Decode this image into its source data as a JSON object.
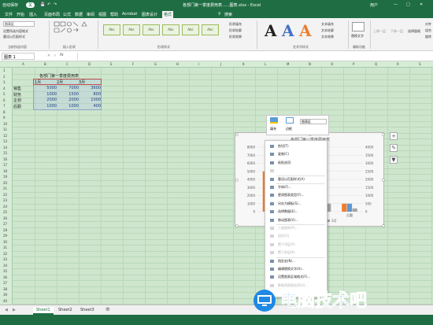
{
  "titlebar": {
    "autosave": "自动保存",
    "toggle": "关",
    "doc_title": "各部门第一季度费用表......图表.xlsx - Excel",
    "user": "用户"
  },
  "tabs": [
    "文件",
    "开始",
    "插入",
    "页面布局",
    "公式",
    "数据",
    "审阅",
    "视图",
    "帮助",
    "Acrobat",
    "图表设计",
    "格式"
  ],
  "active_tab": "格式",
  "tell_me": "搜索",
  "ribbon": {
    "selection_dropdown": "图表区",
    "format_selection": "设置所选内容格式",
    "reset_style": "重设以匹配样式",
    "group_current": "当前所选内容",
    "group_insert_shapes": "插入形状",
    "group_shape_styles": "形状样式",
    "group_art": "艺术字样式",
    "group_accessibility": "辅助功能",
    "style_label": "Abc",
    "shape_fill": "形状填充",
    "shape_outline": "形状轮廓",
    "shape_effect": "形状效果",
    "text_fill": "文本填充",
    "text_outline": "文本轮廓",
    "text_effect": "文本效果",
    "alt_text": "替换文字",
    "bring_forward": "上移一层",
    "send_backward": "下移一层",
    "selection_pane": "选择窗格",
    "align": "对齐",
    "combine": "组合",
    "rotate": "旋转",
    "art_letter": "A"
  },
  "formula_bar": {
    "name_box": "图表 1",
    "fx": "fx"
  },
  "columns": [
    "A",
    "B",
    "C",
    "D",
    "E",
    "F",
    "G",
    "H",
    "I",
    "J",
    "K",
    "L",
    "M",
    "N",
    "O",
    "P",
    "Q",
    "R",
    "S"
  ],
  "rows": [
    "1",
    "2",
    "3",
    "4",
    "5",
    "6",
    "7",
    "8",
    "9",
    "10",
    "11",
    "12",
    "13",
    "14",
    "15",
    "16",
    "17",
    "18",
    "19",
    "20",
    "21",
    "22",
    "23",
    "24",
    "25",
    "26",
    "27",
    "28",
    "29",
    "30",
    "31",
    "32",
    "33",
    "34",
    "35",
    "36",
    "37",
    "38",
    "39",
    "40"
  ],
  "table": {
    "title": "各部门第一季度费用表",
    "headers": [
      "1月",
      "2月",
      "3月"
    ],
    "rows": [
      {
        "dept": "销售",
        "values": [
          "5000",
          "7000",
          "3600"
        ]
      },
      {
        "dept": "财务",
        "values": [
          "1000",
          "1500",
          "800"
        ]
      },
      {
        "dept": "企划",
        "values": [
          "2000",
          "2000",
          "1000"
        ]
      },
      {
        "dept": "后勤",
        "values": [
          "1000",
          "1000",
          "400"
        ]
      }
    ]
  },
  "chart_data": {
    "type": "bar",
    "title": "各部门第一季度费用表",
    "categories": [
      "销售",
      "财务",
      "企划",
      "后勤"
    ],
    "series": [
      {
        "name": "1月",
        "values": [
          5000,
          1000,
          2000,
          1000
        ],
        "color": "#ed7d31"
      },
      {
        "name": "2月",
        "values": [
          7000,
          1500,
          2000,
          1000
        ],
        "color": "#5b9bd5"
      },
      {
        "name": "3月",
        "values": [
          3600,
          800,
          1000,
          400
        ],
        "color": "#a5a5a5"
      }
    ],
    "left_ticks": [
      "8000",
      "7000",
      "6000",
      "5000",
      "4000",
      "3000",
      "2000",
      "1000",
      "0"
    ],
    "right_ticks": [
      "4000",
      "3500",
      "3000",
      "2500",
      "2000",
      "1500",
      "1000",
      "500",
      "0"
    ],
    "ylim": [
      0,
      8000
    ]
  },
  "context_menu": {
    "mini_fill": "填充",
    "mini_outline": "边框",
    "mini_dropdown": "图表区",
    "items": [
      {
        "label": "剪切(T)",
        "enabled": true
      },
      {
        "label": "复制(C)",
        "enabled": true
      },
      {
        "label": "粘贴选项:",
        "enabled": true
      },
      {
        "label": "",
        "enabled": false
      },
      {
        "label": "重设以匹配样式(A)",
        "enabled": true
      },
      {
        "label": "字体(F)...",
        "enabled": true
      },
      {
        "label": "更改图表类型(Y)...",
        "enabled": true
      },
      {
        "label": "另存为模板(S)...",
        "enabled": true
      },
      {
        "label": "选择数据(E)...",
        "enabled": true
      },
      {
        "label": "移动图表(V)...",
        "enabled": true
      },
      {
        "label": "三维旋转(R)...",
        "enabled": false
      },
      {
        "label": "组合(G)",
        "enabled": false
      },
      {
        "label": "置于顶层(R)",
        "enabled": false
      },
      {
        "label": "置于底层(K)",
        "enabled": false
      },
      {
        "label": "指定宏(N)...",
        "enabled": true
      },
      {
        "label": "编辑替换文字(A)...",
        "enabled": true
      },
      {
        "label": "设置图表区域格式(F)...",
        "enabled": true
      },
      {
        "label": "数据透视图选项(O)...",
        "enabled": false
      }
    ]
  },
  "sheet_tabs": [
    "Sheet1",
    "Sheet2",
    "Sheet3"
  ],
  "active_sheet": "Sheet1",
  "watermark": "电脑技术吧"
}
